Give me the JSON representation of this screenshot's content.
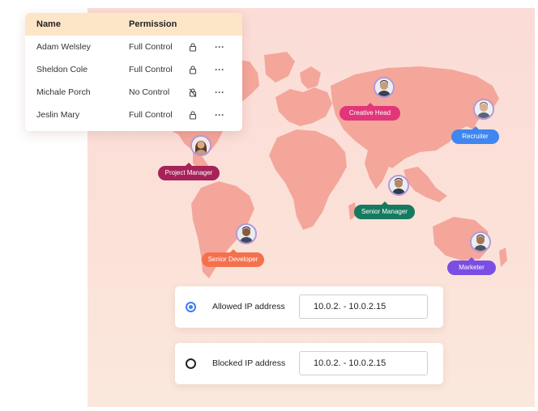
{
  "permissions_table": {
    "headers": {
      "name": "Name",
      "permission": "Permission"
    },
    "rows": [
      {
        "name": "Adam Welsley",
        "permission": "Full Control",
        "lock_icon": "lock-icon"
      },
      {
        "name": "Sheldon Cole",
        "permission": "Full Control",
        "lock_icon": "lock-icon"
      },
      {
        "name": "Michale Porch",
        "permission": "No Control",
        "lock_icon": "unlock-icon"
      },
      {
        "name": "Jeslin Mary",
        "permission": "Full Control",
        "lock_icon": "lock-icon"
      }
    ],
    "more_label": "···"
  },
  "roles": [
    {
      "label": "Creative Head",
      "color": "#e2357a"
    },
    {
      "label": "Recruiter",
      "color": "#3f86f1"
    },
    {
      "label": "Project Manager",
      "color": "#a62258"
    },
    {
      "label": "Senior Manager",
      "color": "#167a60"
    },
    {
      "label": "Senior Developer",
      "color": "#f4714e"
    },
    {
      "label": "Marketer",
      "color": "#7b4ee3"
    }
  ],
  "ip_rules": [
    {
      "label": "Allowed IP address",
      "value": "10.0.2. - 10.0.2.15",
      "selected": true
    },
    {
      "label": "Blocked  IP address",
      "value": "10.0.2. - 10.0.2.15",
      "selected": false
    }
  ],
  "colors": {
    "map_fill": "#f4a69b",
    "table_header": "#fde6c8",
    "radio_accent": "#3d7ef1"
  }
}
